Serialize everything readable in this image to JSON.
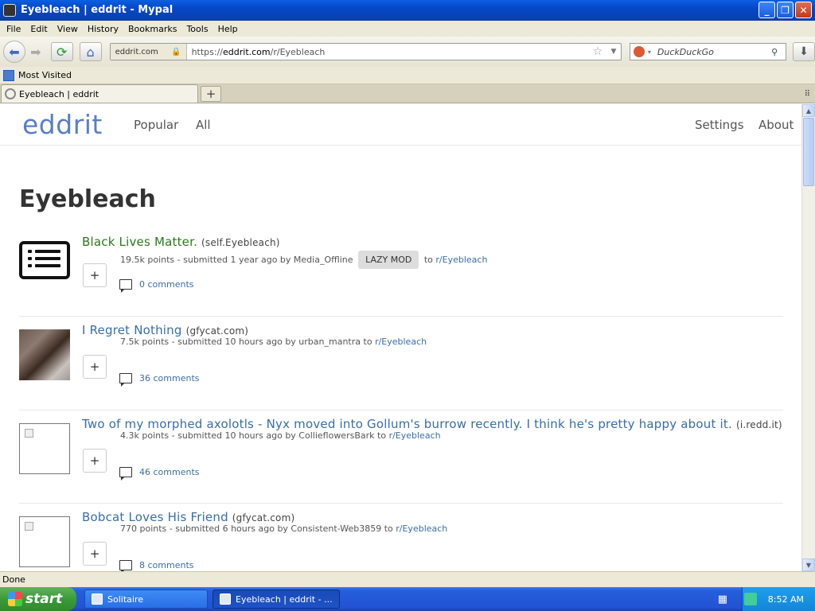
{
  "window": {
    "title": "Eyebleach | eddrit - Mypal"
  },
  "menu": [
    "File",
    "Edit",
    "View",
    "History",
    "Bookmarks",
    "Tools",
    "Help"
  ],
  "nav": {
    "site_identity": "eddrit.com",
    "url_prefix": "https://",
    "url_host": "eddrit.com",
    "url_path": "/r/Eyebleach",
    "search_placeholder": "DuckDuckGo"
  },
  "bookmarks": {
    "most_visited": "Most Visited"
  },
  "tabs": [
    {
      "label": "Eyebleach | eddrit"
    }
  ],
  "site": {
    "logo": "eddrit",
    "nav_left": [
      "Popular",
      "All"
    ],
    "nav_right": [
      "Settings",
      "About"
    ]
  },
  "page": {
    "title": "Eyebleach"
  },
  "posts": [
    {
      "title": "Black Lives Matter.",
      "domain": "(self.Eyebleach)",
      "points": "19.5k points",
      "submitted": "submitted 1 year ago by Media_Offline",
      "flair": "LAZY MOD",
      "to": "to",
      "subreddit": "r/Eyebleach",
      "comments": "0 comments",
      "thumb": "self"
    },
    {
      "title": "I Regret Nothing",
      "domain": "(gfycat.com)",
      "points": "7.5k points",
      "submitted": "submitted 10 hours ago by urban_mantra",
      "to": "to",
      "subreddit": "r/Eyebleach",
      "comments": "36 comments",
      "thumb": "image"
    },
    {
      "title": "Two of my morphed axolotls - Nyx moved into Gollum's burrow recently. I think he's pretty happy about it.",
      "domain": "(i.redd.it)",
      "points": "4.3k points",
      "submitted": "submitted 10 hours ago by CollieflowersBark",
      "to": "to",
      "subreddit": "r/Eyebleach",
      "comments": "46 comments",
      "thumb": "broken"
    },
    {
      "title": "Bobcat Loves His Friend",
      "domain": "(gfycat.com)",
      "points": "770 points",
      "submitted": "submitted 6 hours ago by Consistent-Web3859",
      "to": "to",
      "subreddit": "r/Eyebleach",
      "comments": "8 comments",
      "thumb": "broken"
    }
  ],
  "status": {
    "text": "Done"
  },
  "taskbar": {
    "start": "start",
    "tasks": [
      "Solitaire",
      "Eyebleach | eddrit - ..."
    ],
    "clock": "8:52 AM"
  },
  "colors": {
    "link": "#3a6ea8",
    "logo": "#5a7ec6",
    "self_title": "#2a7a1a",
    "xp_blue": "#245edb"
  }
}
